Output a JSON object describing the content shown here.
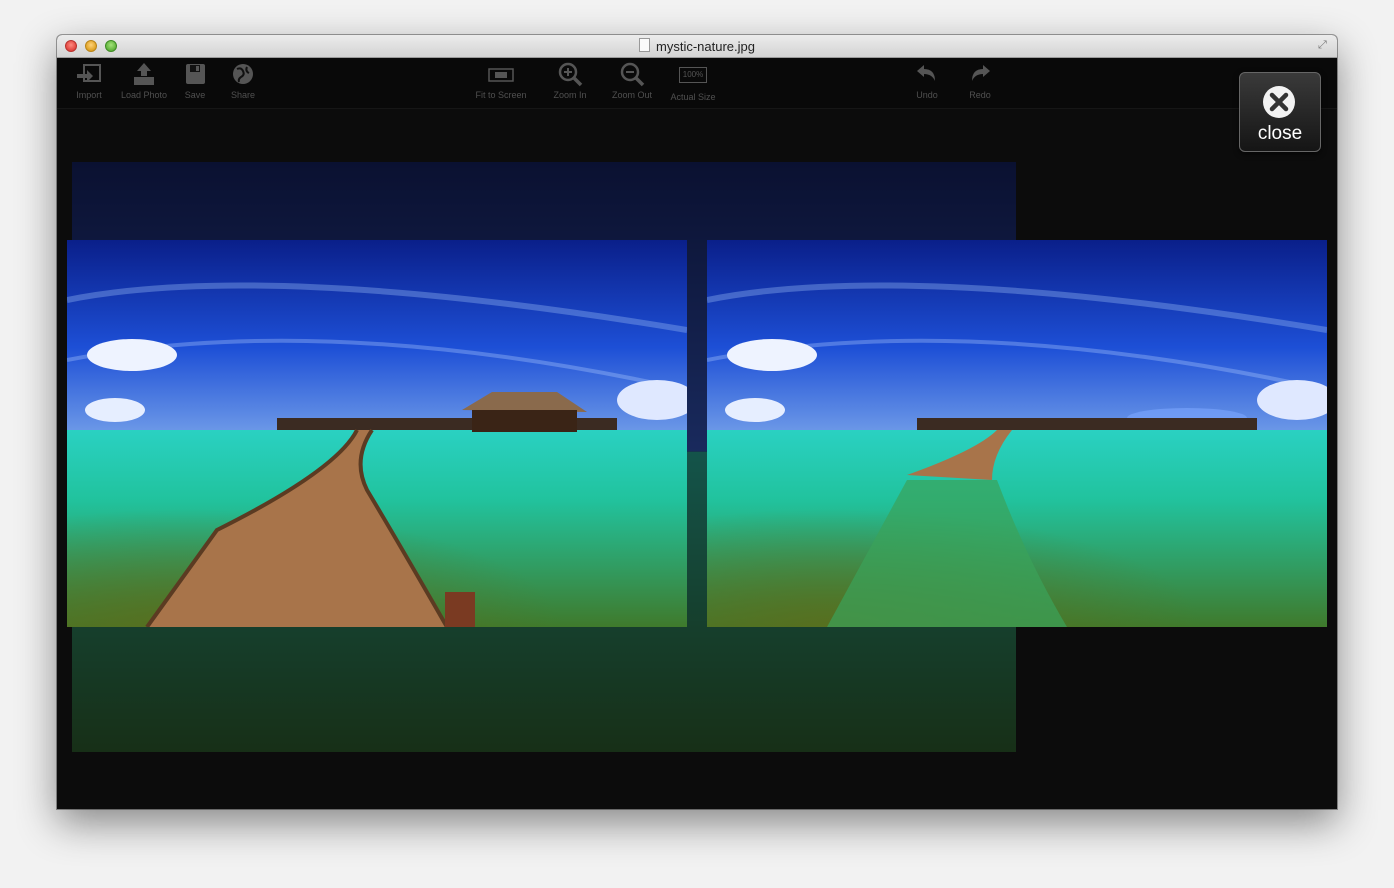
{
  "window": {
    "title": "mystic-nature.jpg"
  },
  "toolbar": {
    "import": "Import",
    "load_photo": "Load Photo",
    "save": "Save",
    "share": "Share",
    "fit_to_screen": "Fit to Screen",
    "zoom_in": "Zoom In",
    "zoom_out": "Zoom Out",
    "actual_size": "Actual Size",
    "actual_size_badge": "100%",
    "undo": "Undo",
    "redo": "Redo"
  },
  "overlay": {
    "close_label": "close"
  },
  "colors": {
    "window_bg": "#0c0c0c",
    "toolbar_text": "#505050",
    "sky_deep": "#0a1f8a",
    "water_turquoise": "#21c39e",
    "boardwalk": "#a8744a"
  },
  "icons": {
    "import": "import-icon",
    "load_photo": "upload-icon",
    "save": "floppy-disk-icon",
    "share": "globe-icon",
    "fit_to_screen": "fit-screen-icon",
    "zoom_in": "magnifier-plus-icon",
    "zoom_out": "magnifier-minus-icon",
    "actual_size": "actual-size-icon",
    "undo": "undo-arrow-icon",
    "redo": "redo-arrow-icon",
    "close": "close-x-icon"
  }
}
